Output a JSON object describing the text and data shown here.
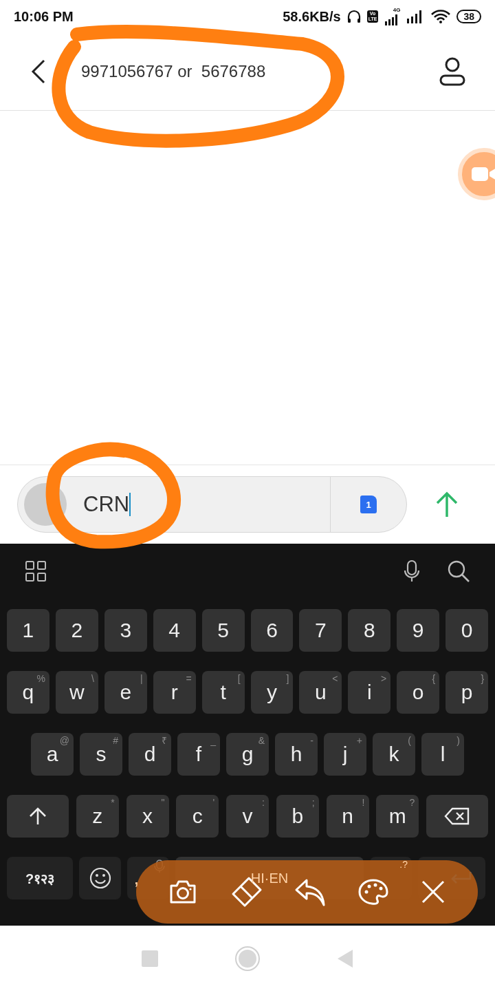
{
  "status_bar": {
    "time": "10:06 PM",
    "speed": "58.6KB/s",
    "volte": [
      "Vo",
      "LTE"
    ],
    "network": "4G",
    "battery": "38"
  },
  "header": {
    "title": "9971056767 or  5676788"
  },
  "composer": {
    "value": "CRN",
    "sim": "1"
  },
  "keyboard": {
    "number_row": [
      "1",
      "2",
      "3",
      "4",
      "5",
      "6",
      "7",
      "8",
      "9",
      "0"
    ],
    "rows": [
      [
        {
          "key": "q",
          "hint": "%"
        },
        {
          "key": "w",
          "hint": "\\"
        },
        {
          "key": "e",
          "hint": "|"
        },
        {
          "key": "r",
          "hint": "="
        },
        {
          "key": "t",
          "hint": "["
        },
        {
          "key": "y",
          "hint": "]"
        },
        {
          "key": "u",
          "hint": "<"
        },
        {
          "key": "i",
          "hint": ">"
        },
        {
          "key": "o",
          "hint": "{"
        },
        {
          "key": "p",
          "hint": "}"
        }
      ],
      [
        {
          "key": "a",
          "hint": "@"
        },
        {
          "key": "s",
          "hint": "#"
        },
        {
          "key": "d",
          "hint": "₹"
        },
        {
          "key": "f",
          "hint": "_"
        },
        {
          "key": "g",
          "hint": "&"
        },
        {
          "key": "h",
          "hint": "-"
        },
        {
          "key": "j",
          "hint": "+"
        },
        {
          "key": "k",
          "hint": "("
        },
        {
          "key": "l",
          "hint": ")"
        }
      ],
      [
        {
          "key": "z",
          "hint": "*"
        },
        {
          "key": "x",
          "hint": "\""
        },
        {
          "key": "c",
          "hint": "'"
        },
        {
          "key": "v",
          "hint": ":"
        },
        {
          "key": "b",
          "hint": ";"
        },
        {
          "key": "n",
          "hint": "!"
        },
        {
          "key": "m",
          "hint": "?"
        }
      ]
    ],
    "bottom": {
      "symbols": "?१२३",
      "comma": ",",
      "space": "HI·EN",
      "period_hint": ".?"
    }
  },
  "overlay_toolbar": {
    "tools": [
      {
        "kind": "camera"
      },
      {
        "kind": "eraser"
      },
      {
        "kind": "undo"
      },
      {
        "kind": "palette"
      },
      {
        "kind": "close"
      }
    ]
  }
}
